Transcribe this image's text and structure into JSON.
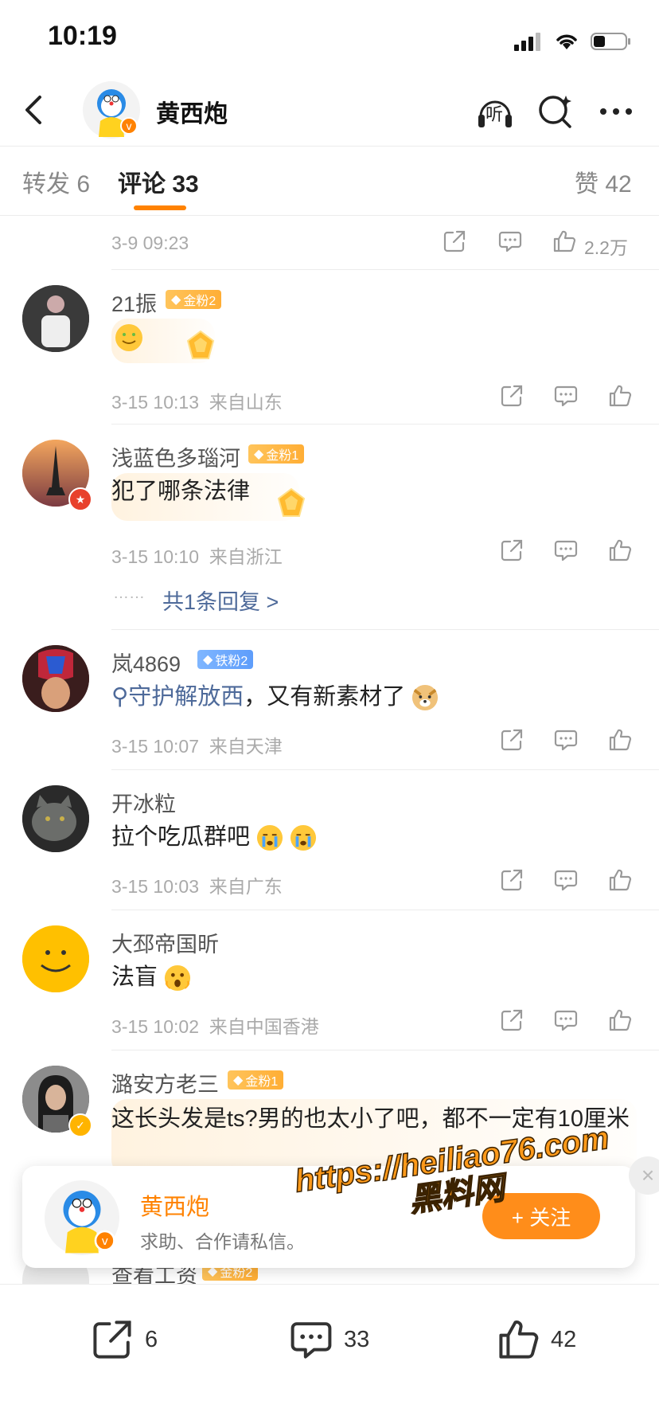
{
  "status_bar": {
    "time": "10:19"
  },
  "header": {
    "user_name": "黄西炮",
    "listen_label": "听"
  },
  "tabs": {
    "repost": {
      "label": "转发",
      "count": "6"
    },
    "comments": {
      "label": "评论",
      "count": "33"
    },
    "likes": {
      "label": "赞",
      "count": "42"
    }
  },
  "post_meta": {
    "time": "3-9 09:23",
    "like_count": "2.2万"
  },
  "comments": [
    {
      "user": "21振",
      "badge": "金粉2",
      "text": "",
      "time": "3-15 10:13",
      "location": "来自山东"
    },
    {
      "user": "浅蓝色多瑙河",
      "badge": "金粉1",
      "text": "犯了哪条法律",
      "time": "3-15 10:10",
      "location": "来自浙江",
      "reply_link": "共1条回复 >"
    },
    {
      "user": "岚4869",
      "badge": "铁粉2",
      "topic": "守护解放西",
      "text": "，又有新素材了",
      "time": "3-15 10:07",
      "location": "来自天津"
    },
    {
      "user": "开冰粒",
      "text": "拉个吃瓜群吧",
      "time": "3-15 10:03",
      "location": "来自广东"
    },
    {
      "user": "大邳帝国昕",
      "text": "法盲",
      "time": "3-15 10:02",
      "location": "来自中国香港"
    },
    {
      "user": "潞安方老三",
      "badge": "金粉1",
      "text": "这长头发是ts?男的也太小了吧，都不一定有10厘米"
    },
    {
      "user": "查看工资",
      "badge": "金粉2"
    }
  ],
  "follow_card": {
    "name": "黄西炮",
    "description": "求助、合作请私信。",
    "button": "+ 关注",
    "close": "×"
  },
  "watermark": {
    "line1": "https://heiliao76.com",
    "line2": "黑料网"
  },
  "bottom_bar": {
    "repost_count": "6",
    "comment_count": "33",
    "like_count": "42"
  },
  "colors": {
    "accent": "#ff8200",
    "link": "#4e6a9a",
    "gold_badge": "#ffb23f",
    "iron_badge": "#6aa6fd"
  }
}
